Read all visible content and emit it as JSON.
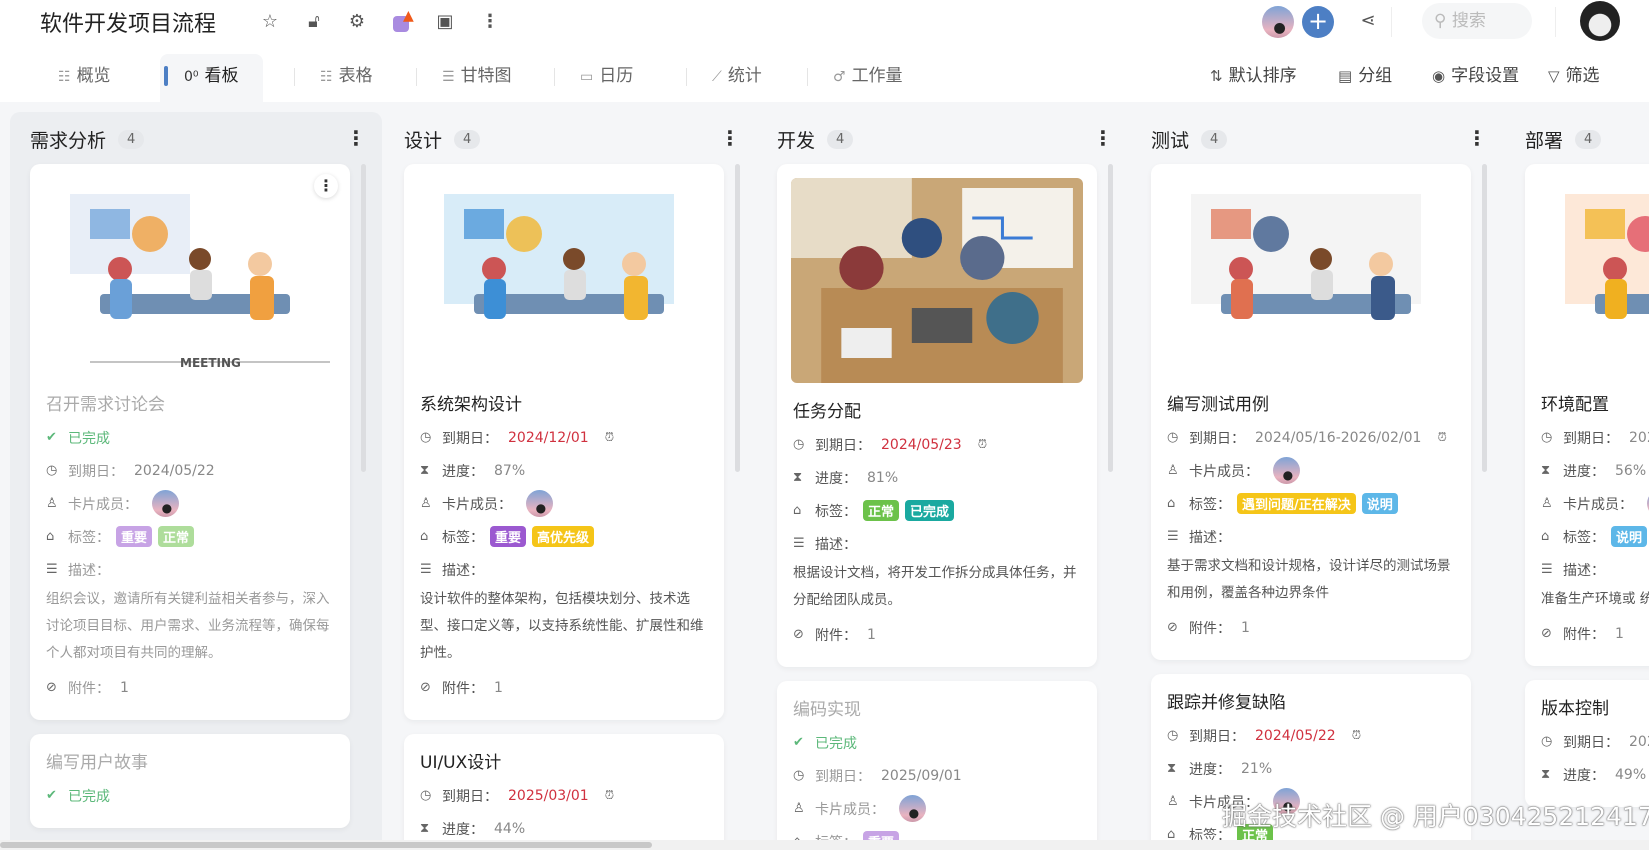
{
  "header": {
    "title": "软件开发项目流程",
    "search_placeholder": "搜索"
  },
  "tabs": [
    {
      "icon": "list-icon",
      "glyph": "☷",
      "label": "概览"
    },
    {
      "icon": "kanban-icon",
      "glyph": "0⁰",
      "label": "看板",
      "active": true
    },
    {
      "icon": "table-icon",
      "glyph": "☷",
      "label": "表格"
    },
    {
      "icon": "gantt-icon",
      "glyph": "☰",
      "label": "甘特图"
    },
    {
      "icon": "calendar-icon",
      "glyph": "▭",
      "label": "日历"
    },
    {
      "icon": "chart-icon",
      "glyph": "⟋",
      "label": "统计"
    },
    {
      "icon": "workload-icon",
      "glyph": "♂",
      "label": "工作量"
    }
  ],
  "tools": [
    {
      "icon": "sort-icon",
      "glyph": "⇅",
      "label": "默认排序"
    },
    {
      "icon": "group-icon",
      "glyph": "▤",
      "label": "分组"
    },
    {
      "icon": "eye-icon",
      "glyph": "◉",
      "label": "字段设置"
    },
    {
      "icon": "filter-icon",
      "glyph": "▽",
      "label": "筛选"
    }
  ],
  "labels": {
    "status": "已完成",
    "due": "到期日：",
    "progress": "进度：",
    "member": "卡片成员：",
    "tags": "标签：",
    "desc": "描述：",
    "attach": "附件："
  },
  "colors": {
    "purple": "#9b59d0",
    "green": "#6cc24a",
    "teal": "#1aa9a0",
    "yellow": "#f5c518",
    "blue": "#5db7e8",
    "red": "#d0313f"
  },
  "columns": [
    {
      "name": "需求分析",
      "count": "4",
      "cards": [
        {
          "title": "召开需求讨论会",
          "done": true,
          "image": "meeting",
          "rows": [
            {
              "t": "status"
            },
            {
              "t": "due",
              "v": "2024/05/22"
            },
            {
              "t": "member"
            },
            {
              "t": "tags",
              "tags": [
                {
                  "text": "重要",
                  "color": "purple"
                },
                {
                  "text": "正常",
                  "color": "green"
                }
              ]
            },
            {
              "t": "desc",
              "v": "组织会议，邀请所有关键利益相关者参与，深入讨论项目目标、用户需求、业务流程等，确保每个人都对项目有共同的理解。"
            },
            {
              "t": "attach",
              "v": "1"
            }
          ]
        },
        {
          "title": "编写用户故事",
          "done": true,
          "rows": [
            {
              "t": "status"
            }
          ]
        }
      ]
    },
    {
      "name": "设计",
      "count": "4",
      "cards": [
        {
          "title": "系统架构设计",
          "image": "office",
          "rows": [
            {
              "t": "due",
              "v": "2024/12/01",
              "red": true,
              "alarm": true
            },
            {
              "t": "progress",
              "v": "87%"
            },
            {
              "t": "member"
            },
            {
              "t": "tags",
              "tags": [
                {
                  "text": "重要",
                  "color": "purple"
                },
                {
                  "text": "高优先级",
                  "color": "yellow"
                }
              ]
            },
            {
              "t": "desc",
              "v": "设计软件的整体架构，包括模块划分、技术选型、接口定义等，以支持系统性能、扩展性和维护性。"
            },
            {
              "t": "attach",
              "v": "1"
            }
          ]
        },
        {
          "title": "UI/UX设计",
          "rows": [
            {
              "t": "due",
              "v": "2025/03/01",
              "red": true,
              "alarm": true
            },
            {
              "t": "progress",
              "v": "44%"
            }
          ]
        }
      ]
    },
    {
      "name": "开发",
      "count": "4",
      "cards": [
        {
          "title": "任务分配",
          "image": "photo",
          "rows": [
            {
              "t": "due",
              "v": "2024/05/23",
              "red": true,
              "alarm": true
            },
            {
              "t": "progress",
              "v": "81%"
            },
            {
              "t": "tags",
              "tags": [
                {
                  "text": "正常",
                  "color": "green"
                },
                {
                  "text": "已完成",
                  "color": "teal"
                }
              ]
            },
            {
              "t": "desc",
              "v": "根据设计文档，将开发工作拆分成具体任务，并分配给团队成员。"
            },
            {
              "t": "attach",
              "v": "1"
            }
          ]
        },
        {
          "title": "编码实现",
          "done": true,
          "rows": [
            {
              "t": "status"
            },
            {
              "t": "due",
              "v": "2025/09/01"
            },
            {
              "t": "member"
            },
            {
              "t": "tags",
              "tags": [
                {
                  "text": "重要",
                  "color": "purple"
                }
              ]
            }
          ]
        }
      ]
    },
    {
      "name": "测试",
      "count": "4",
      "cards": [
        {
          "title": "编写测试用例",
          "image": "presentation",
          "rows": [
            {
              "t": "due",
              "v": "2024/05/16-2026/02/01",
              "alarm": true
            },
            {
              "t": "member"
            },
            {
              "t": "tags",
              "tags": [
                {
                  "text": "遇到问题/正在解决",
                  "color": "yellow"
                },
                {
                  "text": "说明",
                  "color": "blue"
                }
              ]
            },
            {
              "t": "desc",
              "v": "基于需求文档和设计规格，设计详尽的测试场景和用例，覆盖各种边界条件"
            },
            {
              "t": "attach",
              "v": "1"
            }
          ]
        },
        {
          "title": "跟踪并修复缺陷",
          "rows": [
            {
              "t": "due",
              "v": "2024/05/22",
              "red": true,
              "alarm": true
            },
            {
              "t": "progress",
              "v": "21%"
            },
            {
              "t": "member"
            },
            {
              "t": "tags",
              "tags": [
                {
                  "text": "正常",
                  "color": "green"
                }
              ]
            }
          ]
        }
      ]
    },
    {
      "name": "部署",
      "count": "4",
      "cards": [
        {
          "title": "环境配置",
          "image": "team",
          "rows": [
            {
              "t": "due",
              "v": "202"
            },
            {
              "t": "progress",
              "v": "56%"
            },
            {
              "t": "member"
            },
            {
              "t": "tags",
              "tags": [
                {
                  "text": "说明",
                  "color": "blue"
                }
              ]
            },
            {
              "t": "desc",
              "v": "准备生产环境或 统、中间件、依"
            },
            {
              "t": "attach",
              "v": "1"
            }
          ]
        },
        {
          "title": "版本控制",
          "rows": [
            {
              "t": "due",
              "v": "202"
            },
            {
              "t": "progress",
              "v": "49%"
            }
          ]
        }
      ]
    }
  ],
  "watermark": "掘金技术社区 @ 用户030425212417"
}
